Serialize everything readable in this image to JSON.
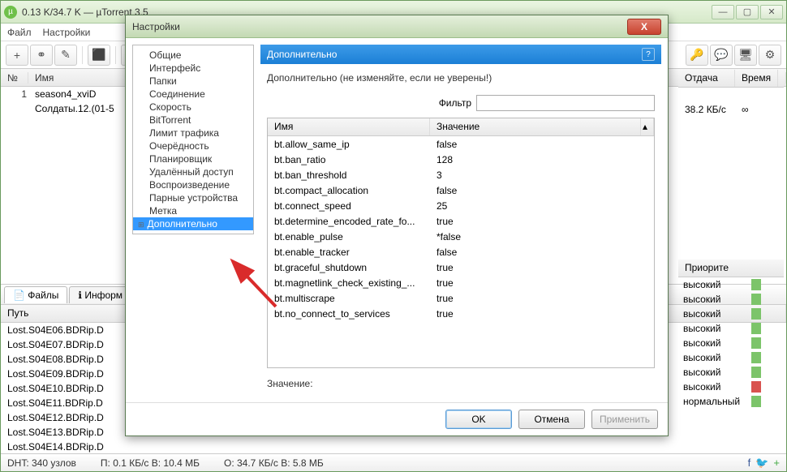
{
  "titlebar": "0.13 K/34.7 K — µTorrent 3.5",
  "menu": [
    "Файл",
    "Настройки"
  ],
  "toolbar_icons": [
    "add",
    "link",
    "new",
    "rss",
    "delete"
  ],
  "right_toolbar_icons": [
    "key",
    "chat",
    "remote",
    "gear"
  ],
  "torrent_header": {
    "num": "№",
    "name": "Имя"
  },
  "torrents": [
    {
      "num": "1",
      "name": "season4_xviD"
    },
    {
      "num": "",
      "name": "Солдаты.12.(01-5"
    }
  ],
  "right_header": {
    "upload": "Отдача",
    "time": "Время"
  },
  "right_row": {
    "upload": "38.2 КБ/с",
    "time": "∞"
  },
  "tabs": {
    "files": "Файлы",
    "info": "Информ"
  },
  "files_header": {
    "path": "Путь"
  },
  "files": [
    "Lost.S04E06.BDRip.D",
    "Lost.S04E07.BDRip.D",
    "Lost.S04E08.BDRip.D",
    "Lost.S04E09.BDRip.D",
    "Lost.S04E10.BDRip.D",
    "Lost.S04E11.BDRip.D",
    "Lost.S04E12.BDRip.D",
    "Lost.S04E13.BDRip.D",
    "Lost.S04E14.BDRip.D"
  ],
  "priority_header": "Приорите",
  "priorities": [
    "высокий",
    "высокий",
    "высокий",
    "высокий",
    "высокий",
    "высокий",
    "высокий",
    "высокий",
    "нормальный"
  ],
  "statusbar": {
    "dht": "DHT: 340 узлов",
    "down": "П: 0.1 КБ/с В: 10.4 МБ",
    "up": "О: 34.7 КБ/с В: 5.8 МБ"
  },
  "dialog": {
    "title": "Настройки",
    "tree": [
      "Общие",
      "Интерфейс",
      "Папки",
      "Соединение",
      "Скорость",
      "BitTorrent",
      "Лимит трафика",
      "Очерёдность",
      "Планировщик",
      "Удалённый доступ",
      "Воспроизведение",
      "Парные устройства",
      "Метка",
      "Дополнительно"
    ],
    "section": "Дополнительно",
    "warning": "Дополнительно (не изменяйте, если не уверены!)",
    "filter_label": "Фильтр",
    "table_header": {
      "name": "Имя",
      "value": "Значение"
    },
    "settings": [
      {
        "name": "bt.allow_same_ip",
        "value": "false"
      },
      {
        "name": "bt.ban_ratio",
        "value": "128"
      },
      {
        "name": "bt.ban_threshold",
        "value": "3"
      },
      {
        "name": "bt.compact_allocation",
        "value": "false"
      },
      {
        "name": "bt.connect_speed",
        "value": "25"
      },
      {
        "name": "bt.determine_encoded_rate_fo...",
        "value": "true"
      },
      {
        "name": "bt.enable_pulse",
        "value": "*false"
      },
      {
        "name": "bt.enable_tracker",
        "value": "false"
      },
      {
        "name": "bt.graceful_shutdown",
        "value": "true"
      },
      {
        "name": "bt.magnetlink_check_existing_...",
        "value": "true"
      },
      {
        "name": "bt.multiscrape",
        "value": "true"
      },
      {
        "name": "bt.no_connect_to_services",
        "value": "true"
      }
    ],
    "value_label": "Значение:",
    "buttons": {
      "ok": "OK",
      "cancel": "Отмена",
      "apply": "Применить"
    }
  }
}
